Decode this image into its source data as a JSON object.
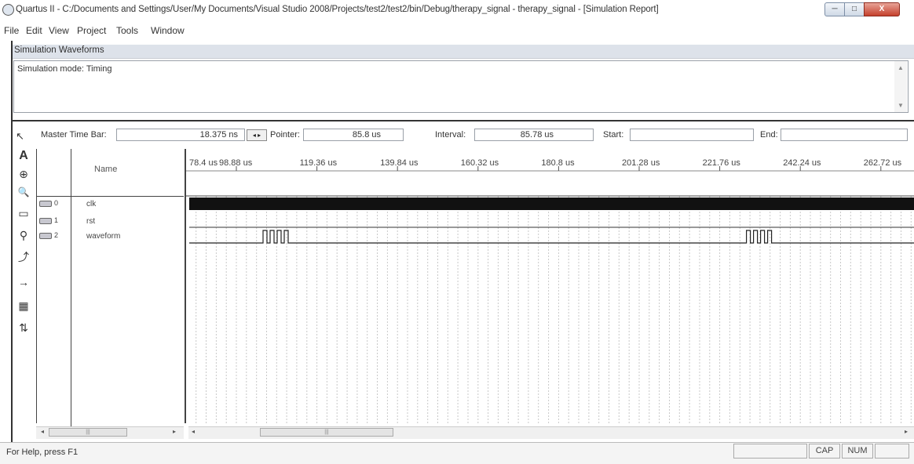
{
  "window": {
    "title": "Quartus II - C:/Documents and Settings/User/My Documents/Visual Studio 2008/Projects/test2/test2/bin/Debug/therapy_signal - therapy_signal - [Simulation Report]",
    "min_glyph": "─",
    "max_glyph": "□",
    "close_glyph": "X"
  },
  "menu": [
    "File",
    "Edit",
    "View",
    "Project",
    "Tools",
    "Window"
  ],
  "panel": {
    "header": "Simulation Waveforms",
    "mode_text": "Simulation mode: Timing",
    "scroll_up": "▲",
    "scroll_down": "▼"
  },
  "timebar": {
    "master_label": "Master Time Bar:",
    "master_value": "18.375 ns",
    "arrows": "◂ ▸",
    "pointer_label": "Pointer:",
    "pointer_value": "85.8 us",
    "interval_label": "Interval:",
    "interval_value": "85.78 us",
    "start_label": "Start:",
    "start_value": "",
    "end_label": "End:",
    "end_value": ""
  },
  "tools": [
    {
      "icon": "pointer-icon",
      "glyph": "↖"
    },
    {
      "icon": "text-tool-icon",
      "glyph": "A"
    },
    {
      "icon": "waveform-edit-icon",
      "glyph": "⊕"
    },
    {
      "icon": "zoom-icon",
      "glyph": "🔍"
    },
    {
      "icon": "full-screen-icon",
      "glyph": "▭"
    },
    {
      "icon": "find-icon",
      "glyph": "⚲"
    },
    {
      "icon": "replace-icon",
      "glyph": "⤴"
    },
    {
      "icon": "arrow-right-icon",
      "glyph": "→"
    },
    {
      "icon": "overwrite-icon",
      "glyph": "▦"
    },
    {
      "icon": "sort-icon",
      "glyph": "⇅"
    }
  ],
  "node_table": {
    "name_header": "Name",
    "nodes": [
      {
        "index": "0",
        "name": "clk"
      },
      {
        "index": "1",
        "name": "rst"
      },
      {
        "index": "2",
        "name": "waveform"
      }
    ]
  },
  "timeline": {
    "first_label": "78.4 us",
    "labels": [
      "98.88 us",
      "119.36 us",
      "139.84 us",
      "160.32 us",
      "180.8 us",
      "201.28 us",
      "221.76 us",
      "242.24 us",
      "262.72 us"
    ]
  },
  "waveform_bursts": [
    {
      "start_us": 98.88,
      "pulses": 4
    },
    {
      "start_us": 221.76,
      "pulses": 4
    }
  ],
  "scroll": {
    "left_arrow": "◂",
    "right_arrow": "▸",
    "thumb_grip": "|||"
  },
  "status": {
    "help_text": "For Help, press F1",
    "cap": "CAP",
    "num": "NUM"
  }
}
